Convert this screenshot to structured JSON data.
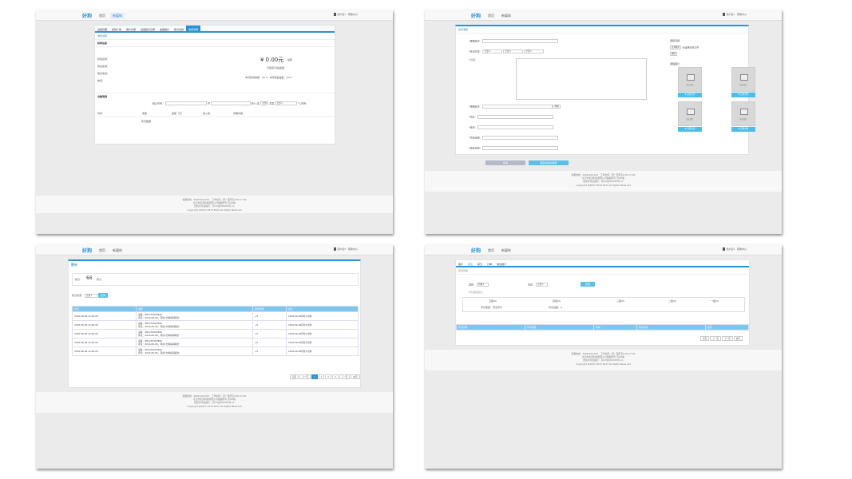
{
  "header": {
    "logo": "好狗",
    "nav": [
      "首页",
      "新媒体"
    ],
    "user": "用户名▾",
    "exit": "帮助中心"
  },
  "footer": {
    "lines": [
      "客服热线：4008-916-912　工作时间：周一至周五9:00-17:00",
      "北京市某某科技有限公司版权所有 京ICP备",
      "经营许可证编号：京ICP证000000号-11",
      "Copyright @2007-2015 Eedo All Rights Reserved"
    ]
  },
  "w1": {
    "tabs": [
      "设备管理",
      "机构广告",
      "用户记录",
      "设备运行记录",
      "金融用户",
      "积分兑换",
      "收费说明"
    ],
    "active_tab": 6,
    "link": "收费说明",
    "section1": "机构信息",
    "fields": [
      "机构名称：",
      "所在区域：",
      "联系电话：",
      "电话："
    ],
    "balance": "¥ 0.00元",
    "balance_link": "提现",
    "withdraw_note": "已提现/可提金额",
    "summary": "本月新增金额：¥0.0　本月收益金额：¥0.0",
    "section2": "余额明细",
    "filter": {
      "label": "起止时间：",
      "to": "至",
      "type_label": "收/入类",
      "type_val": "全部",
      "status_label": "类型",
      "status_val": "全部",
      "search": "查询"
    },
    "cols": [
      "时间",
      "类型",
      "金额（元）",
      "收入类",
      "详细内容"
    ],
    "empty": "暂无数据"
  },
  "w2": {
    "title": "新建课程",
    "labels": [
      "*课程名称：",
      "*所在区域：",
      "*介绍："
    ],
    "region": [
      "全部",
      "全部",
      "全部"
    ],
    "fields2": [
      "*课程名称：",
      "*地址：",
      "*电话：",
      "*开始日期：",
      "*结束日期："
    ],
    "map_btn": "地图",
    "cover_title": "课程海报：",
    "cover_btn": "选择图片",
    "cover_note": "未选择任何文件",
    "cover_del": "删除",
    "pics_title": "课程图片：",
    "pic_label": "暂无图片",
    "pic_btn": "✚ 选择文件",
    "cancel": "取消",
    "submit": "保存并提交审核"
  },
  "w3": {
    "title": "积分",
    "points_label": "积分：",
    "points": "66",
    "points_unit": "积分",
    "filter_label": "积分来源：",
    "filter_val": "全部",
    "filter_btn": "查询",
    "cols": [
      "时间",
      "说明",
      "积分增减",
      "备注"
    ],
    "rows": [
      {
        "time": "2016-06-06 12:00:00",
        "desc1": "设备：SB1234567890",
        "desc2": "评论：2016-06-06，评论1分钟获得积分",
        "delta": "+5",
        "note": "2016-06-06评论1分钟"
      },
      {
        "time": "2016-06-06 12:00:00",
        "desc1": "设备：SB1234567890",
        "desc2": "评论：2016-06-06，评论1分钟获得积分",
        "delta": "+5",
        "note": "2016-06-06评论1分钟"
      },
      {
        "time": "2016-06-06 12:00:00",
        "desc1": "设备：SB1234567890",
        "desc2": "评论：2016-06-06，评论1分钟获得积分",
        "delta": "+5",
        "note": "2016-06-06评论1分钟"
      },
      {
        "time": "2016-06-06 12:00:00",
        "desc1": "设备：SB1234567890",
        "desc2": "评论：2016-06-06，评论1分钟获得积分",
        "delta": "+5",
        "note": "2016-06-06评论1分钟"
      },
      {
        "time": "2016-06-06 12:00:00",
        "desc1": "设备：SB1234567890",
        "desc2": "评论：2016-06-06，评论1分钟获得积分",
        "delta": "+5",
        "note": "2016-06-06评论1分钟"
      }
    ],
    "pager": [
      "首页",
      "上一页",
      "1",
      "2",
      "3",
      "4",
      "下一页",
      "末页"
    ]
  },
  "w4": {
    "tabs": [
      "用户",
      "评论",
      "积分",
      "订单",
      "信息统计"
    ],
    "active_tab": 1,
    "title": "评论列表",
    "filter1_label": "类别：",
    "filter1_val": "机构",
    "filter2_label": "状态：",
    "filter2_val": "全部",
    "btn": "查询",
    "note": "评价星级统计：",
    "stars": [
      "五星(0)",
      "四星(0)",
      "三星(0)",
      "二星(0)",
      "一星(0)"
    ],
    "stat1": "评价星级：暂无评价",
    "stat2": "评论总数：0",
    "cols": [
      "评论内容",
      "评论星级",
      "机构",
      "评论时间",
      "操作"
    ],
    "pager": [
      "首页",
      "上一页",
      "下一页",
      "末页"
    ]
  },
  "colors": {
    "accent": "#2a92d6",
    "table_head": "#7cc7ef",
    "button": "#5bc0e8"
  }
}
